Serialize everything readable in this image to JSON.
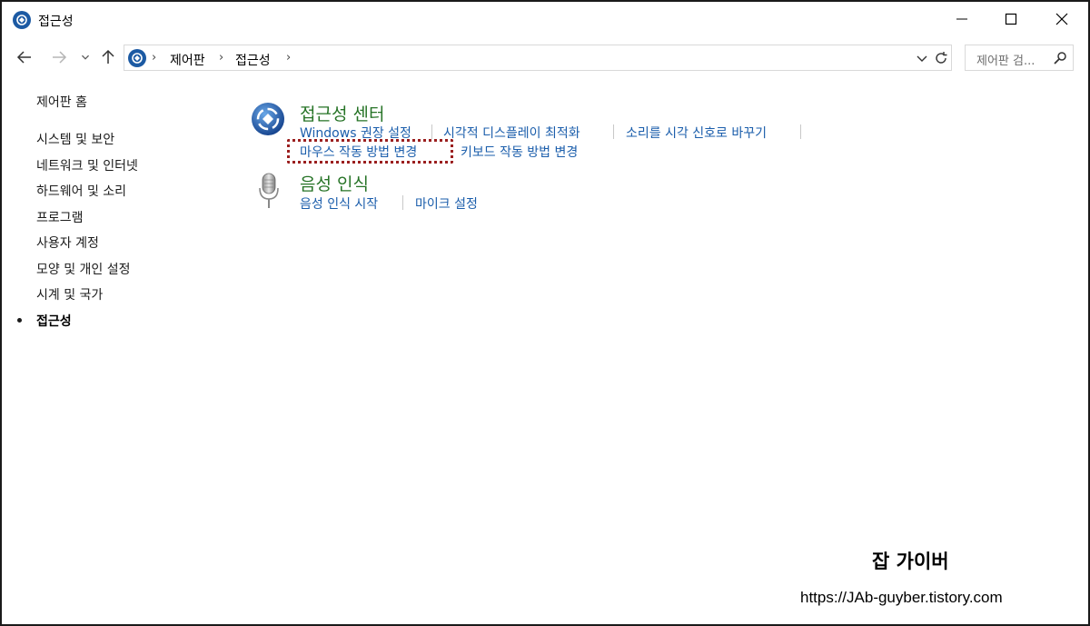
{
  "window": {
    "title": "접근성"
  },
  "address_bar": {
    "crumbs": [
      "제어판",
      "접근성"
    ],
    "search_placeholder": "제어판 검..."
  },
  "sidebar": {
    "home": "제어판 홈",
    "items": [
      {
        "label": "시스템 및 보안"
      },
      {
        "label": "네트워크 및 인터넷"
      },
      {
        "label": "하드웨어 및 소리"
      },
      {
        "label": "프로그램"
      },
      {
        "label": "사용자 계정"
      },
      {
        "label": "모양 및 개인 설정"
      },
      {
        "label": "시계 및 국가"
      },
      {
        "label": "접근성",
        "active": true
      }
    ]
  },
  "categories": [
    {
      "title": "접근성 센터",
      "icon": "ease-of-access-icon",
      "links": [
        "Windows 권장 설정",
        "시각적 디스플레이 최적화",
        "소리를 시각 신호로 바꾸기",
        "마우스 작동 방법 변경",
        "키보드 작동 방법 변경"
      ]
    },
    {
      "title": "음성 인식",
      "icon": "microphone-icon",
      "links": [
        "음성 인식 시작",
        "마이크 설정"
      ]
    }
  ],
  "watermark": {
    "title": "잡 가이버",
    "url": "https://JAb-guyber.tistory.com"
  },
  "colors": {
    "link": "#1a5dab",
    "category_title": "#267326",
    "highlight_border": "#9b1f1f",
    "icon_blue": "#1c5aa3"
  }
}
